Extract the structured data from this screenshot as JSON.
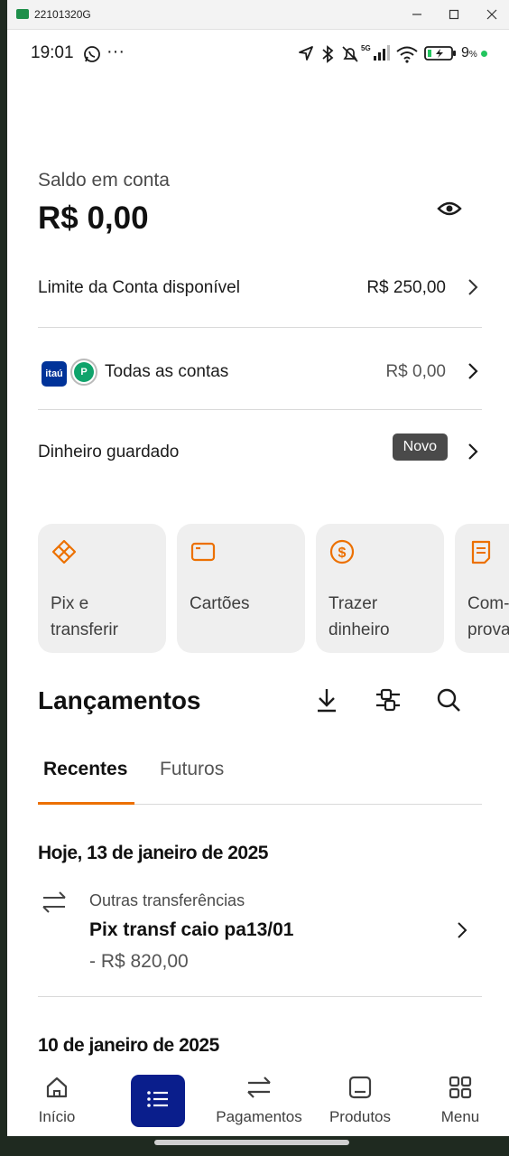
{
  "window": {
    "title": "22101320G"
  },
  "status_bar": {
    "time": "19:01",
    "battery": "9",
    "battery_unit": "%",
    "network": "5G"
  },
  "balance": {
    "label": "Saldo em conta",
    "value": "R$ 0,00"
  },
  "rows": {
    "limit": {
      "label": "Limite da Conta disponível",
      "value": "R$ 250,00"
    },
    "accounts": {
      "logo_itau": "itaú",
      "logo_pp": "P",
      "label": "Todas as contas",
      "value": "R$ 0,00"
    },
    "saved": {
      "label": "Dinheiro guardado",
      "badge": "Novo"
    }
  },
  "cards": [
    {
      "icon": "pix-icon",
      "label": "Pix e\ntransferir"
    },
    {
      "icon": "card-icon",
      "label": "Cartões"
    },
    {
      "icon": "dollar-circle-icon",
      "label": "Trazer\ndinheiro"
    },
    {
      "icon": "receipt-icon",
      "label": "Com-\nprova"
    }
  ],
  "lancamentos": {
    "title": "Lançamentos",
    "tabs": [
      "Recentes",
      "Futuros"
    ],
    "groups": [
      {
        "date": "Hoje, 13 de janeiro de 2025",
        "transactions": [
          {
            "category": "Outras transferências",
            "description": "Pix transf caio pa13/01",
            "value": "- R$ 820,00"
          }
        ]
      },
      {
        "date": "10 de janeiro de 2025",
        "transactions": []
      }
    ]
  },
  "bottom_nav": [
    {
      "label": "Início"
    },
    {
      "label": ""
    },
    {
      "label": "Pagamentos"
    },
    {
      "label": "Produtos"
    },
    {
      "label": "Menu"
    }
  ],
  "colors": {
    "accent": "#ec7000",
    "nav_active": "#0a1e8c",
    "itau_blue": "#003399"
  }
}
